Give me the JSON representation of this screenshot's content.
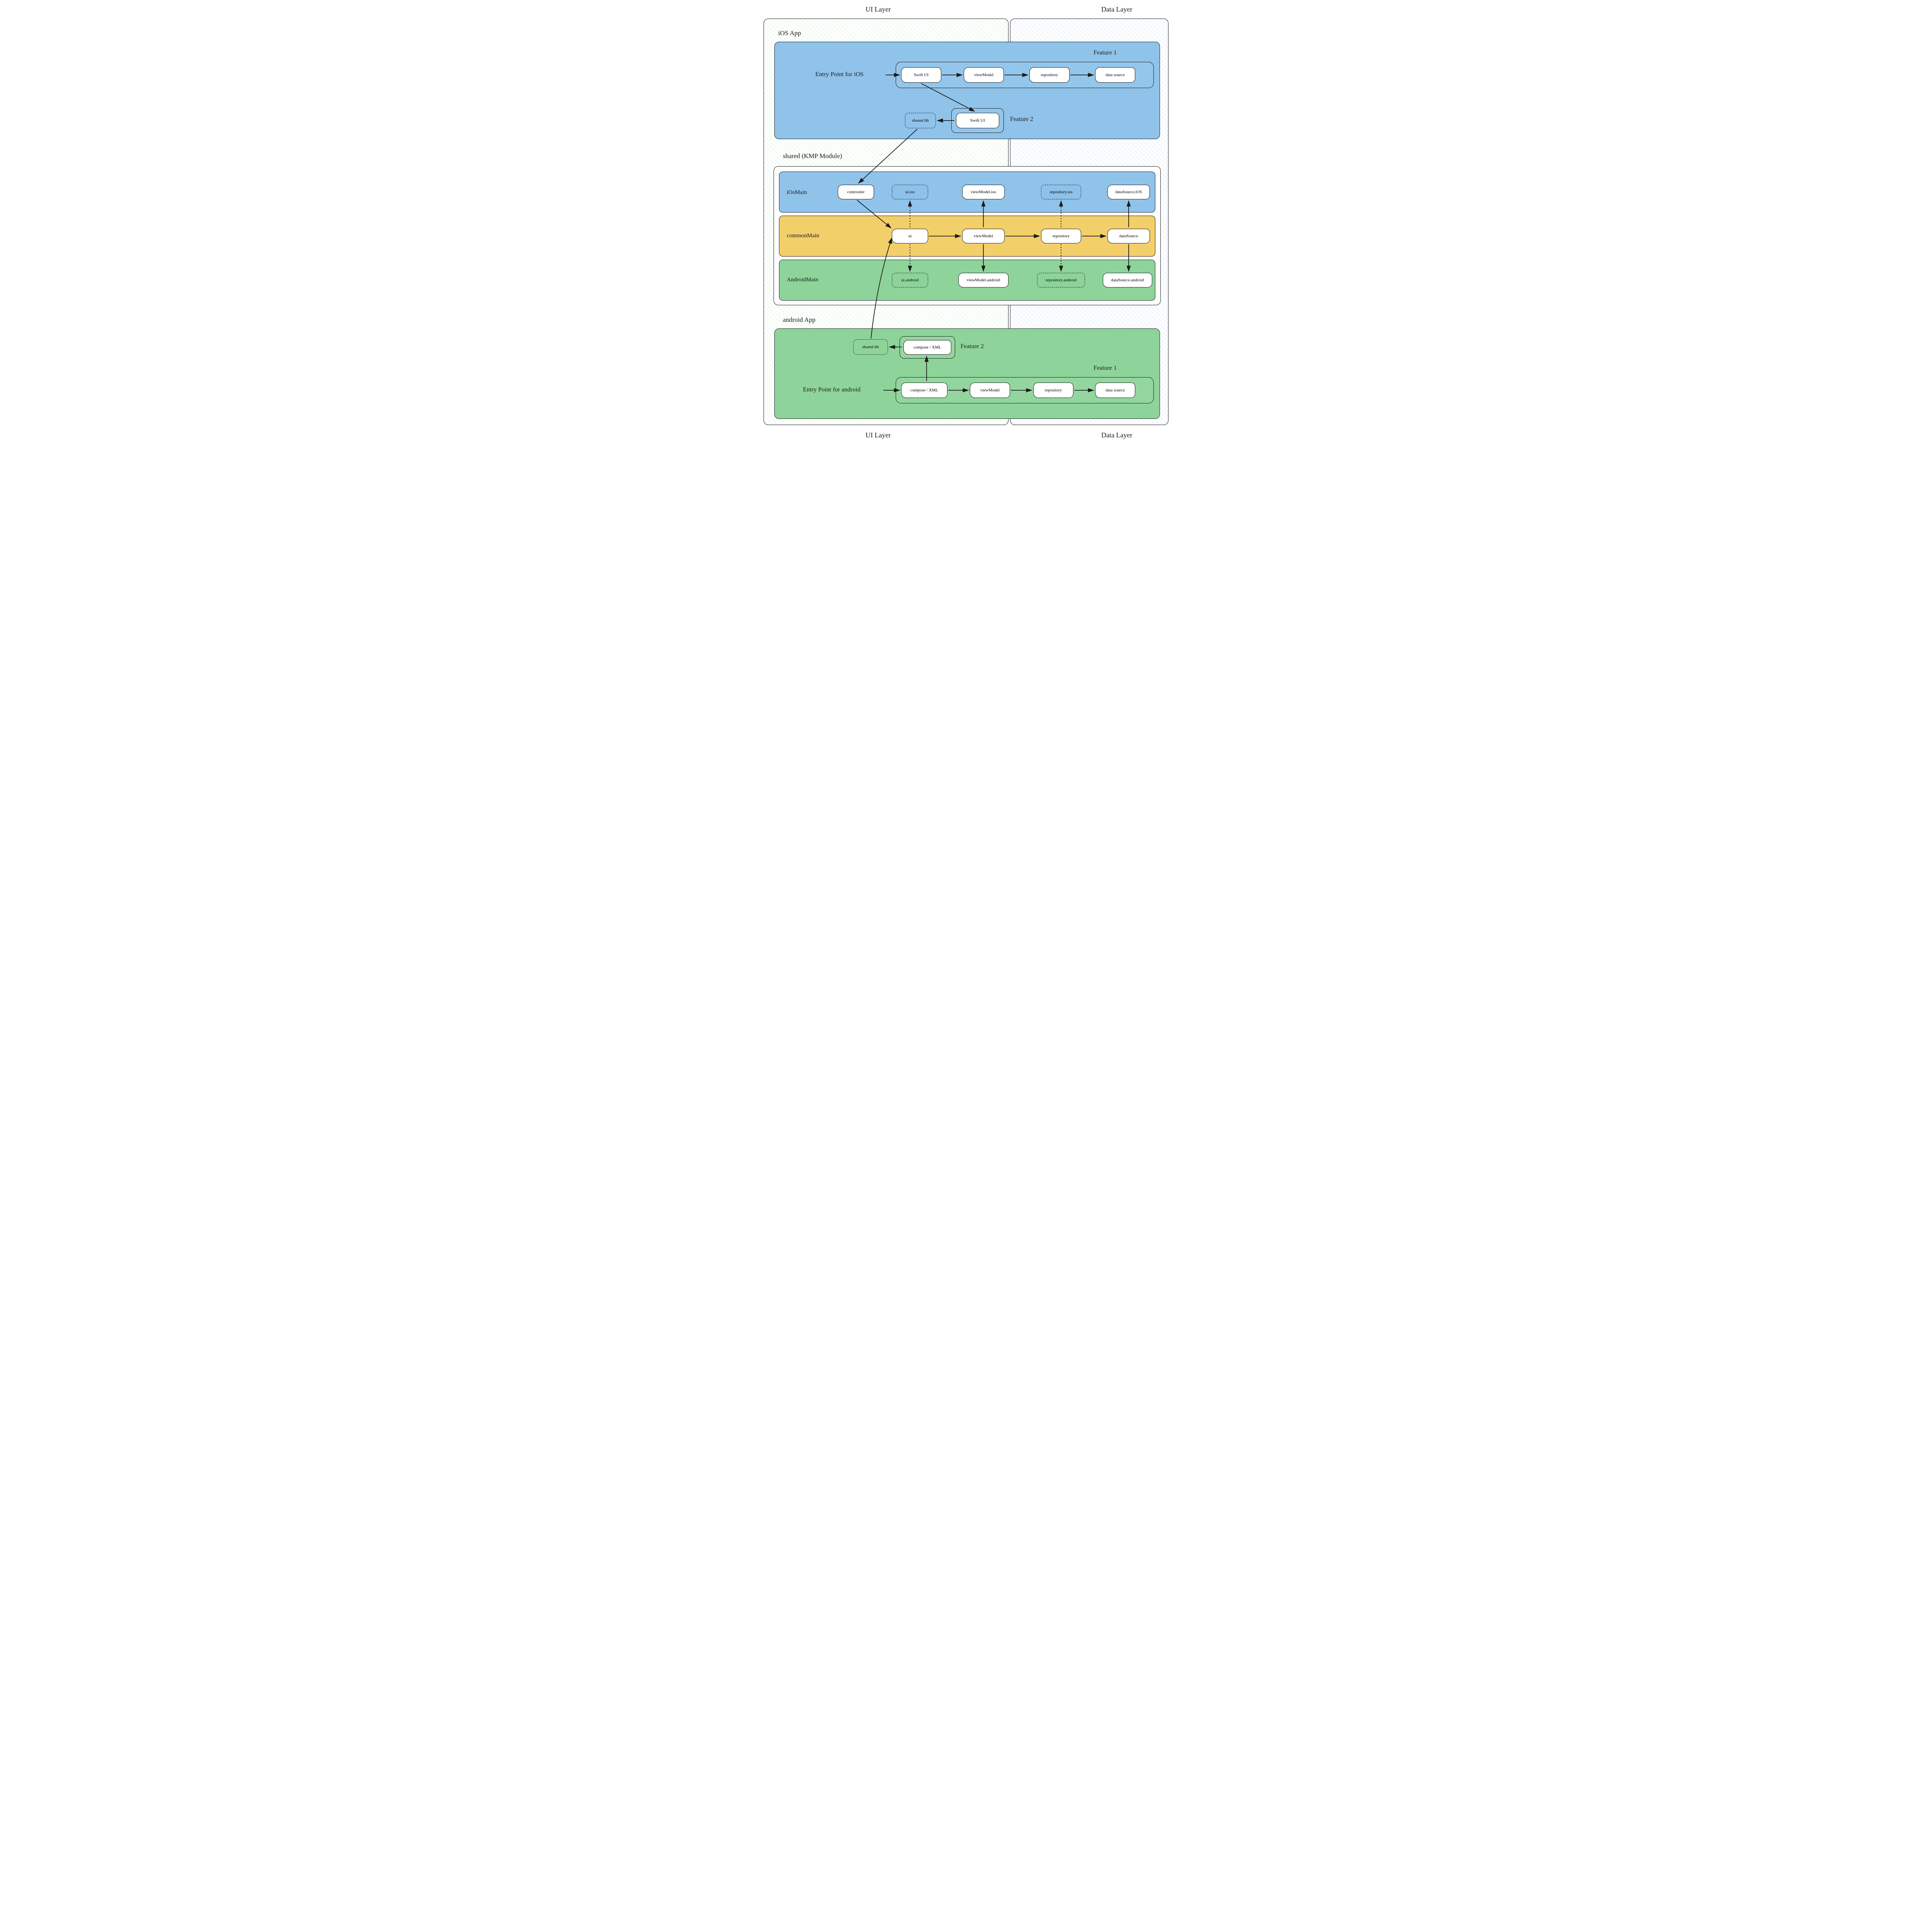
{
  "top": {
    "ui": "UI Layer",
    "data": "Data Layer"
  },
  "bottom": {
    "ui": "UI Layer",
    "data": "Data Layer"
  },
  "ios": {
    "title": "iOS App",
    "entry": "Entry Point for iOS",
    "feature1": {
      "label": "Feature 1",
      "swiftui": "Swift UI",
      "viewmodel": "viewModel",
      "repository": "repository",
      "datasource": "data source"
    },
    "feature2": {
      "label": "Feature 2",
      "swiftui": "Swift UI",
      "sharedlib": "shared lib"
    }
  },
  "shared": {
    "title": "shared (KMP Module)",
    "iosmain": {
      "label": "iOsMain",
      "controller": "controoler",
      "ui_ios": "ui.ios",
      "viewmodel_ios": "viewModel.ios",
      "repository_ios": "repository.ios",
      "datasource_ios": "dataSource.iOS"
    },
    "commonmain": {
      "label": "commonMain",
      "ui": "ui",
      "viewmodel": "viewModel",
      "repository": "repository",
      "datasource": "dataSource"
    },
    "androidmain": {
      "label": "AndroidMain",
      "ui_android": "ui.android",
      "viewmodel_android": "viewModel.android",
      "repository_android": "repository.android",
      "datasource_android": "dataSource.android"
    }
  },
  "android": {
    "title": "android App",
    "entry": "Entry Point for android",
    "feature1": {
      "label": "Feature 1",
      "compose": "compose / XML",
      "viewmodel": "viewModel",
      "repository": "repository",
      "datasource": "data source"
    },
    "feature2": {
      "label": "Feature 2",
      "compose": "compose / XML",
      "sharedlib": "shared lib"
    }
  }
}
